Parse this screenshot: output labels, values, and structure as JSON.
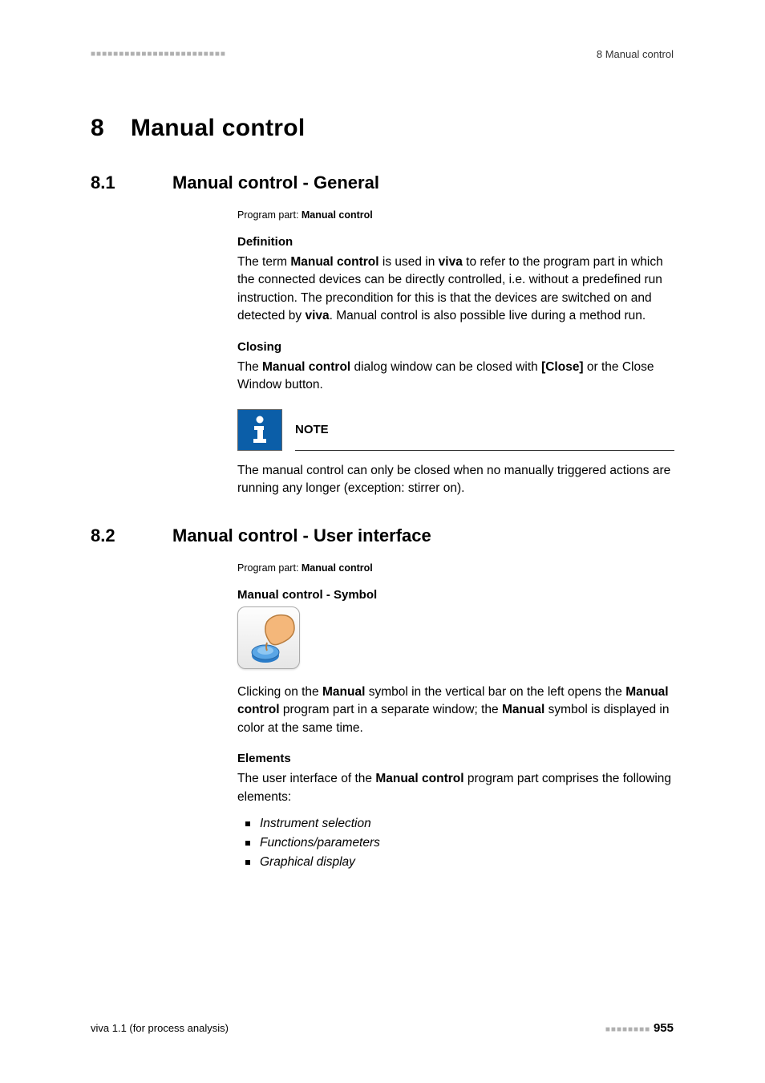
{
  "header": {
    "chapter_ref": "8 Manual control"
  },
  "chapter": {
    "number": "8",
    "title": "Manual control"
  },
  "s81": {
    "number": "8.1",
    "title": "Manual control - General",
    "program_part_label": "Program part: ",
    "program_part_value": "Manual control",
    "definition_head": "Definition",
    "definition_pre": "The term ",
    "definition_b1": "Manual control",
    "definition_mid1": " is used in ",
    "definition_b2": "viva",
    "definition_mid2": " to refer to the program part in which the connected devices can be directly controlled, i.e. without a predefined run instruction. The precondition for this is that the devices are switched on and detected by ",
    "definition_b3": "viva",
    "definition_post": ". Manual control is also possible live during a method run.",
    "closing_head": "Closing",
    "closing_pre": "The ",
    "closing_b1": "Manual control",
    "closing_mid1": " dialog window can be closed with ",
    "closing_b2": "[Close]",
    "closing_post": " or the Close Window button.",
    "note_title": "NOTE",
    "note_text": "The manual control can only be closed when no manually triggered actions are running any longer (exception: stirrer on)."
  },
  "s82": {
    "number": "8.2",
    "title": "Manual control - User interface",
    "program_part_label": "Program part: ",
    "program_part_value": "Manual control",
    "symbol_head": "Manual control - Symbol",
    "symbol_pre": "Clicking on the ",
    "symbol_b1": "Manual",
    "symbol_mid1": " symbol in the vertical bar on the left opens the ",
    "symbol_b2": "Manual control",
    "symbol_mid2": " program part in a separate window; the ",
    "symbol_b3": "Manual",
    "symbol_post": " symbol is displayed in color at the same time.",
    "elements_head": "Elements",
    "elements_pre": "The user interface of the ",
    "elements_b1": "Manual control",
    "elements_post": " program part comprises the following elements:",
    "elements_list": {
      "0": "Instrument selection",
      "1": "Functions/parameters",
      "2": "Graphical display"
    }
  },
  "footer": {
    "left": "viva 1.1 (for process analysis)",
    "page": "955"
  }
}
